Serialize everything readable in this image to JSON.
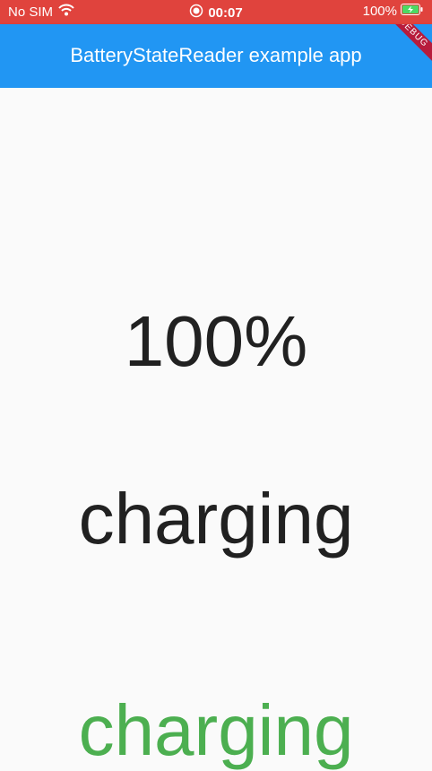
{
  "status_bar": {
    "carrier": "No SIM",
    "time": "00:07",
    "battery_percent": "100%",
    "background_color": "#e0433d",
    "icons": [
      "wifi-icon",
      "record-icon",
      "battery-charging-icon"
    ]
  },
  "app_bar": {
    "title": "BatteryStateReader example app",
    "background_color": "#2196f3",
    "debug_banner": "DEBUG"
  },
  "content": {
    "battery_level": "100%",
    "battery_state": "charging",
    "battery_state_colored": "charging",
    "state_color": "#4caf50"
  }
}
